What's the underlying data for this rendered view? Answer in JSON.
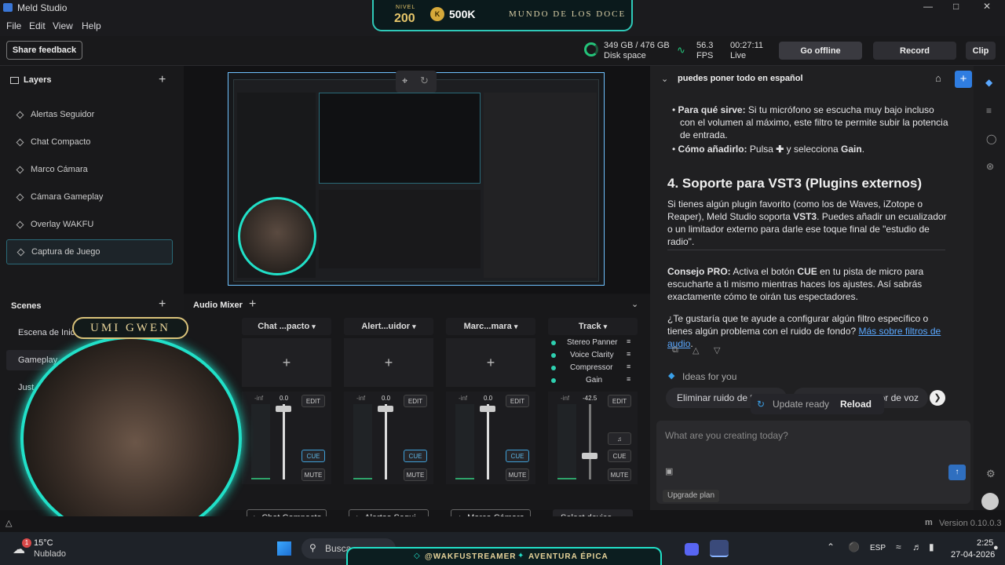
{
  "app": {
    "title": "Meld Studio",
    "menu": [
      "File",
      "Edit",
      "View",
      "Help"
    ]
  },
  "overlay_top": {
    "level_label": "NIVEL",
    "level": "200",
    "coins": "500K",
    "world": "MUNDO DE LOS DOCE"
  },
  "toolbar": {
    "share": "Share feedback",
    "disk": "349 GB / 476 GB",
    "disk_label": "Disk space",
    "fps": "56.3",
    "fps_label": "FPS",
    "time": "00:27:11",
    "time_label": "Live",
    "go_offline": "Go offline",
    "record": "Record",
    "clip": "Clip"
  },
  "layers": {
    "title": "Layers",
    "items": [
      "Alertas Seguidor",
      "Chat Compacto",
      "Marco Cámara",
      "Cámara Gameplay",
      "Overlay WAKFU",
      "Captura de Juego"
    ]
  },
  "scenes": {
    "title": "Scenes",
    "items": [
      "Escena de Inic",
      "Gameplay",
      "Just"
    ]
  },
  "webcam": {
    "name": "UMI GWEN"
  },
  "mixer": {
    "title": "Audio Mixer",
    "channels": [
      {
        "name": "Chat ...pacto",
        "db": "0.0",
        "edit": "EDIT",
        "cue": "CUE",
        "mute": "MUTE",
        "footer": "Chat Compacto"
      },
      {
        "name": "Alert...uidor",
        "db": "0.0",
        "edit": "EDIT",
        "cue": "CUE",
        "mute": "MUTE",
        "footer": "Alertas Segui..."
      },
      {
        "name": "Marc...mara",
        "db": "0.0",
        "edit": "EDIT",
        "cue": "CUE",
        "mute": "MUTE",
        "footer": "Marco Cámara"
      }
    ],
    "track": {
      "name": "Track",
      "filters": [
        "Stereo Panner",
        "Voice Clarity",
        "Compressor",
        "Gain"
      ],
      "db": "-42.5",
      "edit": "EDIT",
      "cue": "CUE",
      "mute": "MUTE",
      "select": "Select device"
    },
    "inf": "-inf"
  },
  "chat": {
    "header": "puedes poner todo en español",
    "b1_bold": "Para qué sirve:",
    "b1": " Si tu micrófono se escucha muy bajo incluso con el volumen al máximo, este filtro te permite subir la potencia de entrada.",
    "b2_bold": "Cómo añadirlo:",
    "b2a": " Pulsa ",
    "b2b": " y selecciona ",
    "b2c": "Gain",
    "h4": "4. Soporte para VST3 (Plugins externos)",
    "p1a": "Si tienes algún plugin favorito (como los de Waves, iZotope o Reaper), Meld Studio soporta ",
    "p1b": "VST3",
    "p1c": ". Puedes añadir un ecualizador o un limitador externo para darle ese toque final de \"estudio de radio\".",
    "p2a": "Consejo PRO:",
    "p2b": " Activa el botón ",
    "p2c": "CUE",
    "p2d": " en tu pista de micro para escucharte a ti mismo mientras haces los ajustes. Así sabrás exactamente cómo te oirán tus espectadores.",
    "p3": "¿Te gustaría que te ayude a configurar algún filtro específico o tienes algún problema con el ruido de fondo? ",
    "p3link": "Más sobre filtros de audio",
    "ideas": "Ideas for you",
    "idea1": "Eliminar ruido de t",
    "idea2": "esor de voz",
    "update": "Update ready",
    "reload": "Reload",
    "placeholder": "What are you creating today?",
    "upgrade": "Upgrade plan"
  },
  "statusbar": {
    "version": "Version 0.10.0.3"
  },
  "overlay_bottom": {
    "handle": "@WAKFUSTREAMER",
    "tag": "AVENTURA ÉPICA"
  },
  "taskbar": {
    "temp": "15°C",
    "weather": "Nublado",
    "search": "Busca",
    "lang": "ESP",
    "time": "2:25",
    "date": "27-04-2026",
    "badge": "1"
  },
  "colors": {
    "accent": "#2f7de1",
    "teal": "#21e0c8",
    "cue": "#3fa0d8"
  }
}
